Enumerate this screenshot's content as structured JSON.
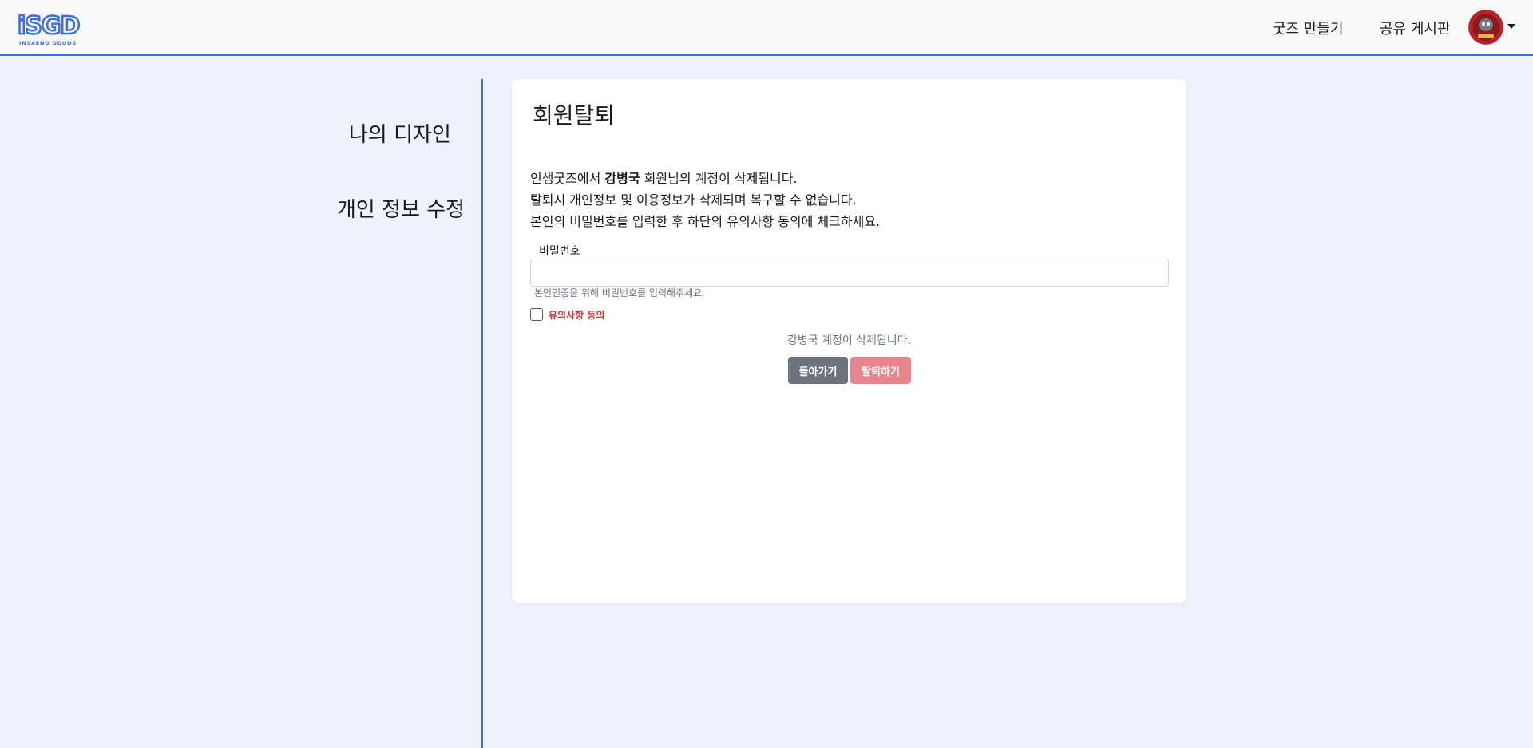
{
  "header": {
    "logo_text": "iSGD",
    "logo_subtext": "INSAENG GOODS",
    "nav_make": "굿즈 만들기",
    "nav_board": "공유 게시판"
  },
  "sidebar": {
    "my_design": "나의 디자인",
    "edit_info": "개인 정보 수정"
  },
  "card": {
    "title": "회원탈퇴",
    "notice_line1_prefix": "인생굿즈에서 ",
    "notice_line1_name": "강병국",
    "notice_line1_suffix": " 회원님의 계정이 삭제됩니다.",
    "notice_line2": "탈퇴시 개인정보 및 이용정보가 삭제되며 복구할 수 없습니다.",
    "notice_line3": "본인의 비밀번호를 입력한 후 하단의 유의사항 동의에 체크하세요.",
    "password_label": "비밀번호",
    "password_value": "",
    "password_help": "본인인증을 위해 비밀번호를 입력해주세요.",
    "agree_label": "유의사항 동의",
    "agree_checked": false,
    "status_text": "강병국 계정이 삭제됩니다.",
    "back_button": "돌아가기",
    "withdraw_button": "탈퇴하기"
  },
  "colors": {
    "accent": "#3a6fe0",
    "background": "#eff2fd",
    "back_button": "#6c757d",
    "withdraw_button": "#e8868f",
    "agree_label": "#c43d3d"
  }
}
